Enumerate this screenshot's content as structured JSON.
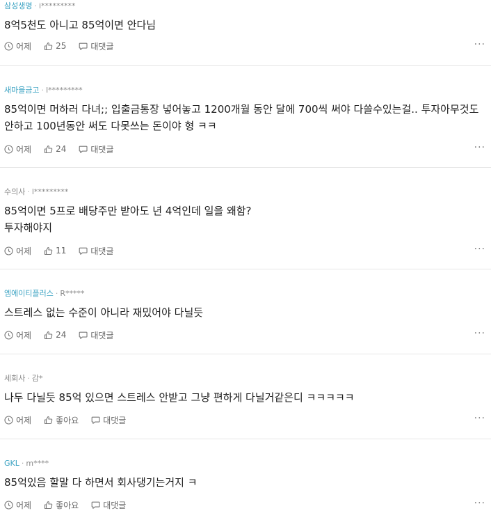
{
  "comments": [
    {
      "company": "삼성생명",
      "user": "i*********",
      "body_lines": [
        "8억5천도 아니고 85억이면 안다님"
      ],
      "time": "어제",
      "likes": "25",
      "reply_label": "대댓글",
      "more": "···"
    },
    {
      "company": "새마을금고",
      "user": "l*********",
      "body_lines": [
        "85억이면 머하러 다녀;; 입출금통장 넣어놓고 1200개월 동안 달에 700씩 써야 다쓸수있는걸.. 투자아무것도 안하고 100년동안 써도 다못쓰는 돈이야 형 ㅋㅋ"
      ],
      "time": "어제",
      "likes": "24",
      "reply_label": "대댓글",
      "more": "···"
    },
    {
      "company": "수의사",
      "user": "l*********",
      "body_lines": [
        "85억이면 5프로 배당주만 받아도 년 4억인데 일을 왜함?",
        "투자해야지"
      ],
      "time": "어제",
      "likes": "11",
      "reply_label": "대댓글",
      "more": "···"
    },
    {
      "company": "엠에이티플러스",
      "user": "R*****",
      "body_lines": [
        "스트레스 없는 수준이 아니라 재밌어야 다닐듯"
      ],
      "time": "어제",
      "likes": "24",
      "reply_label": "대댓글",
      "more": "···"
    },
    {
      "company": "세회사",
      "user": "감*",
      "body_lines": [
        "나두 다닐듯 85억 있으면 스트레스 안받고 그냥 편하게 다닐거같은디 ㅋㅋㅋㅋㅋ"
      ],
      "time": "어제",
      "likes": "좋아요",
      "reply_label": "대댓글",
      "more": "···"
    },
    {
      "company": "GKL",
      "user": "m****",
      "body_lines": [
        "85억있음 할말 다 하면서 회사댕기는거지 ㅋ"
      ],
      "time": "어제",
      "likes": "좋아요",
      "reply_label": "대댓글",
      "more": "···"
    }
  ]
}
